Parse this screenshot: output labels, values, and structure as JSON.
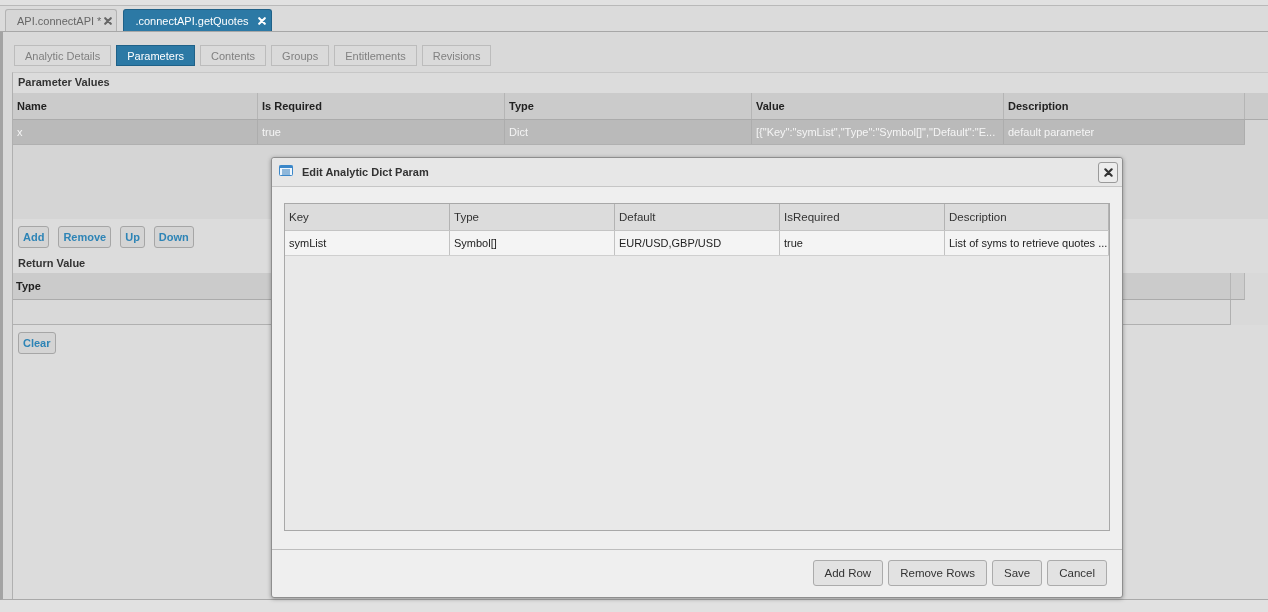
{
  "editor_tabs": [
    {
      "label": "API.connectAPI *",
      "selected": false
    },
    {
      "label": ".connectAPI.getQuotes",
      "selected": true
    }
  ],
  "section_tabs": [
    {
      "label": "Analytic Details",
      "selected": false
    },
    {
      "label": "Parameters",
      "selected": true
    },
    {
      "label": "Contents",
      "selected": false
    },
    {
      "label": "Groups",
      "selected": false
    },
    {
      "label": "Entitlements",
      "selected": false
    },
    {
      "label": "Revisions",
      "selected": false
    }
  ],
  "parameter_values": {
    "title": "Parameter Values",
    "columns": [
      "Name",
      "Is Required",
      "Type",
      "Value",
      "Description"
    ],
    "rows": [
      {
        "cells": [
          "x",
          "true",
          "Dict",
          "[{\"Key\":\"symList\",\"Type\":\"Symbol[]\",\"Default\":\"E...",
          "default parameter"
        ],
        "selected": true
      }
    ],
    "buttons": [
      "Add",
      "Remove",
      "Up",
      "Down"
    ]
  },
  "return_value": {
    "title": "Return Value",
    "columns": [
      "Type"
    ],
    "buttons": [
      "Clear"
    ]
  },
  "dialog": {
    "title": "Edit Analytic Dict Param",
    "columns": [
      "Key",
      "Type",
      "Default",
      "IsRequired",
      "Description"
    ],
    "rows": [
      {
        "cells": [
          "symList",
          "Symbol[]",
          "EUR/USD,GBP/USD",
          "true",
          "List of syms to retrieve quotes ..."
        ],
        "selected": false
      }
    ],
    "buttons": [
      "Add Row",
      "Remove Rows",
      "Save",
      "Cancel"
    ]
  }
}
